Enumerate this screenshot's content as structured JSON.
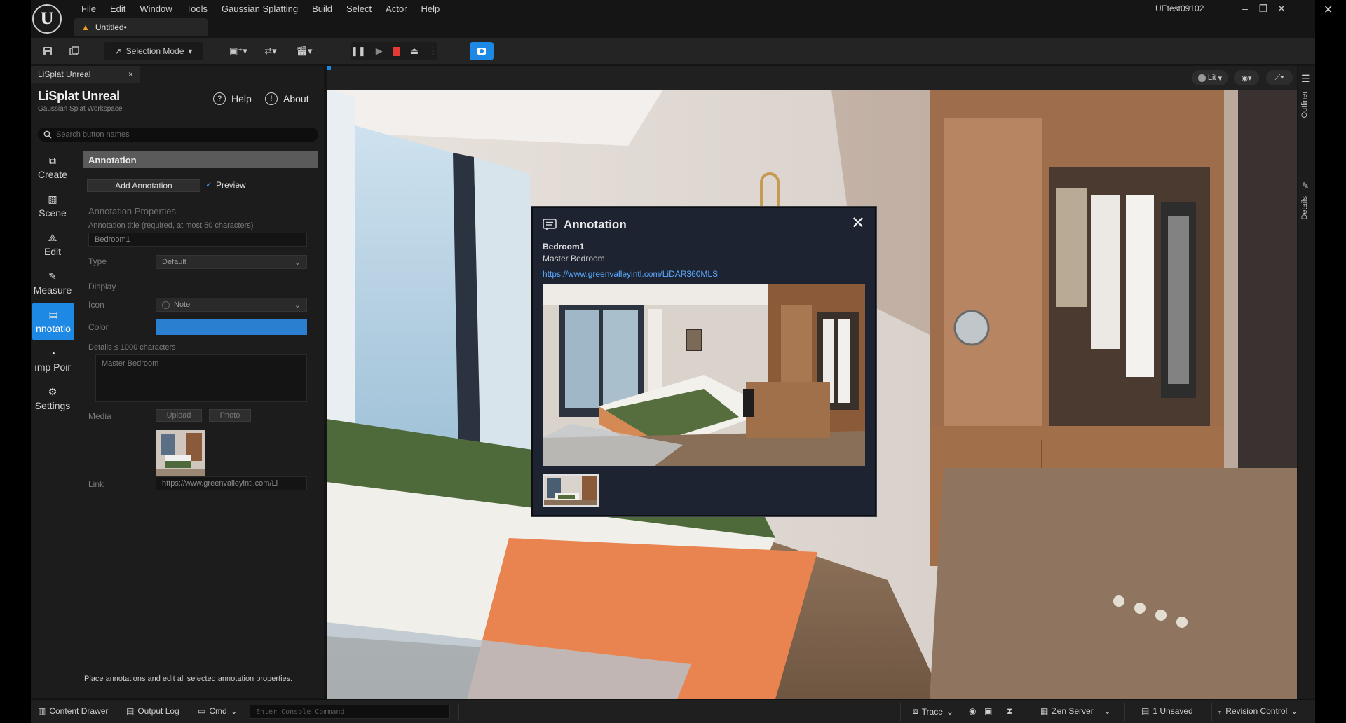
{
  "app": {
    "logo_text": "U",
    "menu": [
      "File",
      "Edit",
      "Window",
      "Tools",
      "Gaussian Splatting",
      "Build",
      "Select",
      "Actor",
      "Help"
    ],
    "document_tab": "Untitled•",
    "project_name": "UEtest09102",
    "window_buttons": [
      "–",
      "❐",
      "✕"
    ]
  },
  "toolbar": {
    "selection_mode": "Selection Mode"
  },
  "plugin": {
    "tab_label": "LiSplat Unreal",
    "tab_close": "×",
    "title": "LiSplat Unreal",
    "subtitle": "Gaussian Splat Workspace",
    "help": "Help",
    "about": "About",
    "search_placeholder": "Search button names",
    "nav": [
      {
        "label": "Create",
        "icon": "create-icon"
      },
      {
        "label": "Scene",
        "icon": "image-icon"
      },
      {
        "label": "Edit",
        "icon": "edit-icon"
      },
      {
        "label": "Measure",
        "icon": "measure-icon"
      },
      {
        "label": "nnotatio",
        "icon": "annotation-icon"
      },
      {
        "label": "ımp Poir",
        "icon": "jump-point-icon"
      },
      {
        "label": "Settings",
        "icon": "settings-icon"
      }
    ],
    "form": {
      "section": "Annotation",
      "add_button": "Add Annotation",
      "preview_label": "Preview",
      "properties_heading": "Annotation Properties",
      "title_label": "Annotation title (required, at most 50 characters)",
      "title_value": "Bedroom1",
      "type_label": "Type",
      "type_value": "Default",
      "display_label": "Display",
      "icon_label": "Icon",
      "icon_value": "Note",
      "color_label": "Color",
      "color_value": "#2a7fd1",
      "details_label": "Details ≤ 1000 characters",
      "details_value": "Master Bedroom",
      "media_label": "Media",
      "upload_button": "Upload",
      "photo_button": "Photo",
      "link_label": "Link",
      "link_value": "https://www.greenvalleyintl.com/Li"
    },
    "hint": "Place annotations and edit all selected annotation properties."
  },
  "viewport": {
    "lit_label": "Lit",
    "right_tabs": [
      "Outliner",
      "Details"
    ]
  },
  "popup": {
    "title": "Annotation",
    "close": "✕",
    "name": "Bedroom1",
    "description": "Master Bedroom",
    "link": "https://www.greenvalleyintl.com/LiDAR360MLS"
  },
  "statusbar": {
    "content_drawer": "Content Drawer",
    "output_log": "Output Log",
    "cmd": "Cmd",
    "console_placeholder": "Enter Console Command",
    "trace": "Trace",
    "zen_server": "Zen Server",
    "unsaved": "1 Unsaved",
    "revision_control": "Revision Control"
  }
}
